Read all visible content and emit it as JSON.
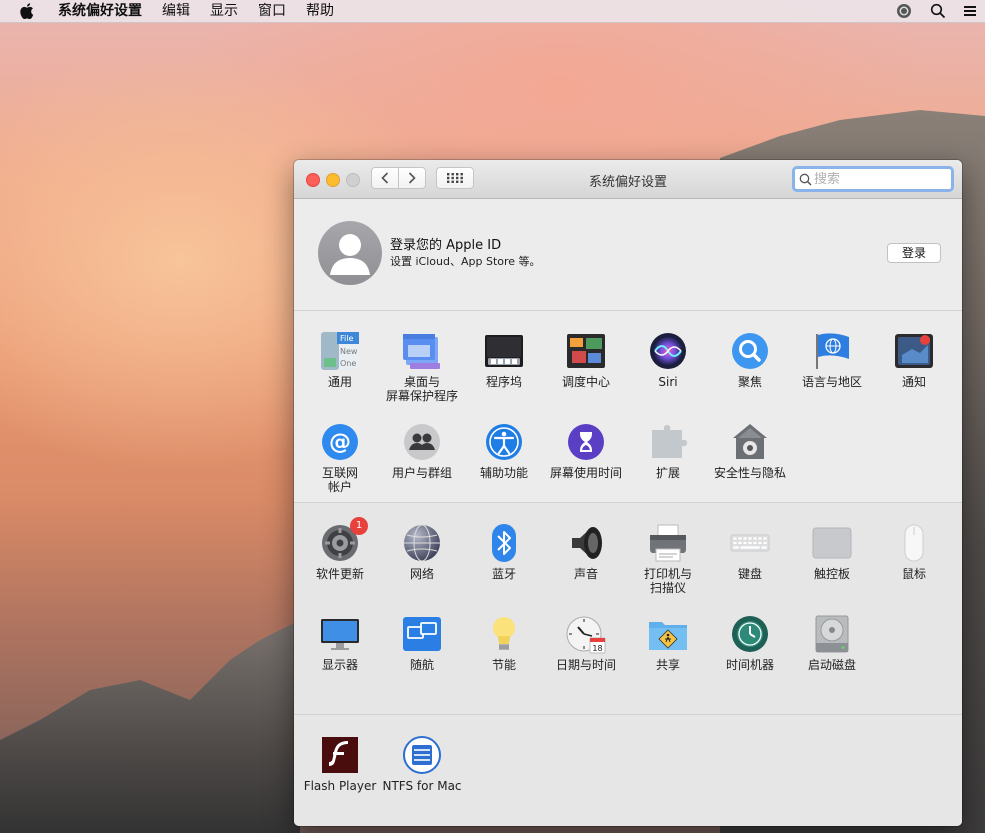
{
  "menubar": {
    "items": [
      "系统偏好设置",
      "编辑",
      "显示",
      "窗口",
      "帮助"
    ]
  },
  "window": {
    "title": "系统偏好设置",
    "search_placeholder": "搜索"
  },
  "account": {
    "title": "登录您的 Apple ID",
    "subtitle": "设置 iCloud、App Store 等。",
    "login_button": "登录"
  },
  "section1": [
    {
      "label": "通用",
      "icon": "general-icon"
    },
    {
      "label": "桌面与\n屏幕保护程序",
      "icon": "desktop-icon"
    },
    {
      "label": "程序坞",
      "icon": "dock-icon"
    },
    {
      "label": "调度中心",
      "icon": "mission-control-icon"
    },
    {
      "label": "Siri",
      "icon": "siri-icon"
    },
    {
      "label": "聚焦",
      "icon": "spotlight-icon"
    },
    {
      "label": "语言与地区",
      "icon": "language-icon"
    },
    {
      "label": "通知",
      "icon": "notifications-icon"
    },
    {
      "label": "互联网\n帐户",
      "icon": "internet-accounts-icon"
    },
    {
      "label": "用户与群组",
      "icon": "users-icon"
    },
    {
      "label": "辅助功能",
      "icon": "accessibility-icon"
    },
    {
      "label": "屏幕使用时间",
      "icon": "screen-time-icon"
    },
    {
      "label": "扩展",
      "icon": "extensions-icon"
    },
    {
      "label": "安全性与隐私",
      "icon": "security-icon"
    }
  ],
  "section2": [
    {
      "label": "软件更新",
      "icon": "software-update-icon",
      "badge": "1"
    },
    {
      "label": "网络",
      "icon": "network-icon"
    },
    {
      "label": "蓝牙",
      "icon": "bluetooth-icon"
    },
    {
      "label": "声音",
      "icon": "sound-icon"
    },
    {
      "label": "打印机与\n扫描仪",
      "icon": "printer-icon"
    },
    {
      "label": "键盘",
      "icon": "keyboard-icon"
    },
    {
      "label": "触控板",
      "icon": "trackpad-icon"
    },
    {
      "label": "鼠标",
      "icon": "mouse-icon"
    },
    {
      "label": "显示器",
      "icon": "displays-icon"
    },
    {
      "label": "随航",
      "icon": "sidecar-icon"
    },
    {
      "label": "节能",
      "icon": "energy-saver-icon"
    },
    {
      "label": "日期与时间",
      "icon": "date-time-icon"
    },
    {
      "label": "共享",
      "icon": "sharing-icon"
    },
    {
      "label": "时间机器",
      "icon": "time-machine-icon"
    },
    {
      "label": "启动磁盘",
      "icon": "startup-disk-icon"
    }
  ],
  "section3": [
    {
      "label": "Flash Player",
      "icon": "flash-player-icon"
    },
    {
      "label": "NTFS for Mac",
      "icon": "ntfs-icon"
    }
  ],
  "general_icon_text": [
    "File",
    "New",
    "One"
  ],
  "calendar_day": "18"
}
